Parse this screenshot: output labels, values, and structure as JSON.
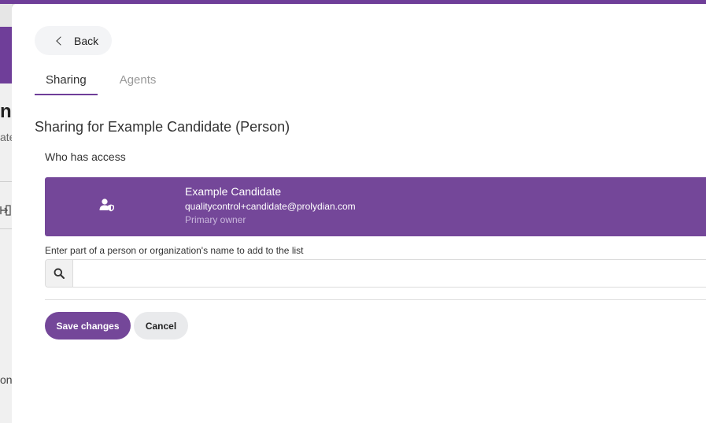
{
  "background": {
    "title_fragment": "nc",
    "subtitle_fragment": "ate",
    "bottom_fragment": "on"
  },
  "panel": {
    "back_label": "Back",
    "tabs": [
      {
        "label": "Sharing",
        "active": true
      },
      {
        "label": "Agents",
        "active": false
      }
    ],
    "heading": "Sharing for Example Candidate (Person)",
    "who_has_access_label": "Who has access",
    "access_list": [
      {
        "name": "Example Candidate",
        "email": "qualitycontrol+candidate@prolydian.com",
        "role": "Primary owner",
        "icon": "person-shield-icon"
      }
    ],
    "search": {
      "hint": "Enter part of a person or organization's name to add to the list",
      "value": "",
      "placeholder": ""
    },
    "save_label": "Save changes",
    "cancel_label": "Cancel"
  },
  "colors": {
    "accent": "#744799",
    "top_bar": "#6f3e99"
  }
}
